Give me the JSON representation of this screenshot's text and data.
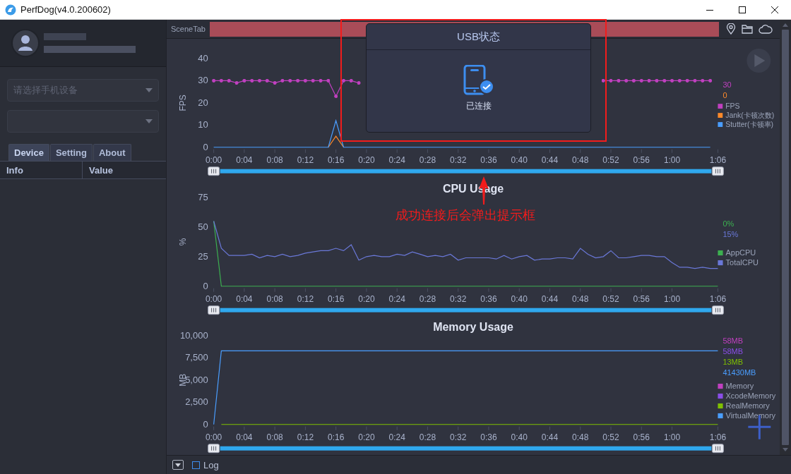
{
  "window": {
    "title": "PerfDog(v4.0.200602)"
  },
  "sidebar": {
    "device_select": {
      "placeholder": "请选择手机设备"
    },
    "tabs": [
      {
        "label": "Device",
        "selected": true
      },
      {
        "label": "Setting",
        "selected": false
      },
      {
        "label": "About",
        "selected": false
      }
    ],
    "table": {
      "columns": [
        "Info",
        "Value"
      ]
    }
  },
  "toolbar": {
    "tab": "SceneTab"
  },
  "sections": [
    {
      "readings": [
        {
          "text": "30",
          "color": "#c040c0"
        },
        {
          "text": "0",
          "color": "#ff8a2a"
        }
      ],
      "chart_data": {
        "type": "line",
        "ylabel": "FPS",
        "legend": "right",
        "x": [
          0,
          1,
          2,
          3,
          4,
          5,
          6,
          7,
          8,
          9,
          10,
          11,
          12,
          13,
          14,
          15,
          16,
          17,
          18,
          19,
          20,
          21,
          22,
          23,
          24,
          25,
          26,
          27,
          28,
          29,
          30,
          31,
          32,
          33,
          34,
          35,
          36,
          37,
          38,
          39,
          40,
          41,
          42,
          43,
          44,
          45,
          46,
          47,
          48,
          49,
          50,
          51,
          52,
          53,
          54,
          55,
          56,
          57,
          58,
          59,
          60,
          61,
          62,
          63,
          64,
          65
        ],
        "xlim": [
          0,
          66
        ],
        "ylim": [
          0,
          40
        ],
        "yticks": [
          0,
          10,
          20,
          30,
          40
        ],
        "xticks": [
          {
            "value": 0,
            "label": "0:00"
          },
          {
            "value": 4,
            "label": "0:04"
          },
          {
            "value": 8,
            "label": "0:08"
          },
          {
            "value": 12,
            "label": "0:12"
          },
          {
            "value": 16,
            "label": "0:16"
          },
          {
            "value": 20,
            "label": "0:20"
          },
          {
            "value": 24,
            "label": "0:24"
          },
          {
            "value": 28,
            "label": "0:28"
          },
          {
            "value": 32,
            "label": "0:32"
          },
          {
            "value": 36,
            "label": "0:36"
          },
          {
            "value": 40,
            "label": "0:40"
          },
          {
            "value": 44,
            "label": "0:44"
          },
          {
            "value": 48,
            "label": "0:48"
          },
          {
            "value": 52,
            "label": "0:52"
          },
          {
            "value": 56,
            "label": "0:56"
          },
          {
            "value": 60,
            "label": "1:00"
          },
          {
            "value": 66,
            "label": "1:06"
          }
        ],
        "series": [
          {
            "name": "FPS",
            "color": "#c040c0",
            "values": [
              30,
              30,
              30,
              29,
              30,
              30,
              30,
              30,
              29,
              30,
              30,
              30,
              30,
              30,
              30,
              30,
              23,
              30,
              30,
              29,
              null,
              null,
              null,
              null,
              null,
              null,
              null,
              null,
              null,
              null,
              null,
              null,
              null,
              null,
              null,
              null,
              null,
              null,
              null,
              null,
              null,
              null,
              null,
              null,
              null,
              null,
              null,
              null,
              null,
              null,
              null,
              30,
              30,
              30,
              30,
              30,
              30,
              30,
              30,
              30,
              30,
              30,
              30,
              30,
              30,
              30
            ]
          },
          {
            "name": "Jank(卡顿次数)",
            "color": "#ff8a2a",
            "values": [
              null,
              null,
              null,
              null,
              null,
              null,
              null,
              null,
              null,
              null,
              null,
              null,
              null,
              null,
              null,
              0,
              5,
              0,
              null,
              null,
              null,
              null,
              null,
              null,
              null,
              null,
              null,
              null,
              null,
              null,
              null,
              null,
              null,
              null,
              null,
              null,
              null,
              null,
              null,
              null,
              null,
              null,
              null,
              null,
              null,
              null,
              null,
              null,
              null,
              null,
              null,
              null,
              null,
              null,
              null,
              null,
              null,
              null,
              null,
              null,
              null,
              null,
              null,
              null,
              null,
              null
            ]
          },
          {
            "name": "Stutter(卡顿率)",
            "color": "#4a9eff",
            "values": [
              0,
              0,
              0,
              0,
              0,
              0,
              0,
              0,
              0,
              0,
              0,
              0,
              0,
              0,
              0,
              0,
              12,
              0,
              0,
              0,
              0,
              0,
              0,
              0,
              0,
              0,
              0,
              0,
              0,
              0,
              0,
              0,
              0,
              0,
              0,
              0,
              0,
              0,
              0,
              0,
              0,
              0,
              0,
              0,
              0,
              0,
              0,
              0,
              0,
              0,
              0,
              0,
              0,
              0,
              0,
              0,
              0,
              0,
              0,
              0,
              0,
              0,
              0,
              0,
              0,
              0
            ]
          }
        ]
      }
    },
    {
      "readings": [
        {
          "text": "0%",
          "color": "#3cb050"
        },
        {
          "text": "15%",
          "color": "#6a78d8"
        }
      ],
      "chart_data": {
        "type": "line",
        "title": "CPU Usage",
        "ylabel": "%",
        "legend": "right",
        "x": [
          0,
          1,
          2,
          3,
          4,
          5,
          6,
          7,
          8,
          9,
          10,
          11,
          12,
          13,
          14,
          15,
          16,
          17,
          18,
          19,
          20,
          21,
          22,
          23,
          24,
          25,
          26,
          27,
          28,
          29,
          30,
          31,
          32,
          33,
          34,
          35,
          36,
          37,
          38,
          39,
          40,
          41,
          42,
          43,
          44,
          45,
          46,
          47,
          48,
          49,
          50,
          51,
          52,
          53,
          54,
          55,
          56,
          57,
          58,
          59,
          60,
          61,
          62,
          63,
          64,
          65,
          66
        ],
        "xlim": [
          0,
          66
        ],
        "ylim": [
          0,
          75
        ],
        "yticks": [
          0,
          25,
          50,
          75
        ],
        "xticks": [
          {
            "value": 0,
            "label": "0:00"
          },
          {
            "value": 4,
            "label": "0:04"
          },
          {
            "value": 8,
            "label": "0:08"
          },
          {
            "value": 12,
            "label": "0:12"
          },
          {
            "value": 16,
            "label": "0:16"
          },
          {
            "value": 20,
            "label": "0:20"
          },
          {
            "value": 24,
            "label": "0:24"
          },
          {
            "value": 28,
            "label": "0:28"
          },
          {
            "value": 32,
            "label": "0:32"
          },
          {
            "value": 36,
            "label": "0:36"
          },
          {
            "value": 40,
            "label": "0:40"
          },
          {
            "value": 44,
            "label": "0:44"
          },
          {
            "value": 48,
            "label": "0:48"
          },
          {
            "value": 52,
            "label": "0:52"
          },
          {
            "value": 56,
            "label": "0:56"
          },
          {
            "value": 60,
            "label": "1:00"
          },
          {
            "value": 66,
            "label": "1:06"
          }
        ],
        "series": [
          {
            "name": "AppCPU",
            "color": "#3cb050",
            "values": [
              55,
              0,
              0,
              0,
              0,
              0,
              0,
              0,
              0,
              0,
              0,
              0,
              0,
              0,
              0,
              0,
              0,
              0,
              0,
              0,
              0,
              0,
              0,
              0,
              0,
              0,
              0,
              0,
              0,
              0,
              0,
              0,
              0,
              0,
              0,
              0,
              0,
              0,
              0,
              0,
              0,
              0,
              0,
              0,
              0,
              0,
              0,
              0,
              0,
              0,
              0,
              0,
              0,
              0,
              0,
              0,
              0,
              0,
              0,
              0,
              0,
              0,
              0,
              0,
              0,
              0,
              0
            ]
          },
          {
            "name": "TotalCPU",
            "color": "#6a78d8",
            "values": [
              55,
              32,
              26,
              26,
              26,
              27,
              24,
              26,
              25,
              27,
              25,
              26,
              28,
              29,
              30,
              30,
              32,
              30,
              35,
              22,
              25,
              26,
              25,
              25,
              27,
              26,
              29,
              27,
              25,
              26,
              25,
              27,
              22,
              24,
              24,
              24,
              24,
              23,
              26,
              23,
              25,
              26,
              22,
              23,
              23,
              24,
              24,
              23,
              32,
              27,
              24,
              25,
              30,
              24,
              24,
              25,
              26,
              26,
              25,
              25,
              20,
              16,
              16,
              15,
              16,
              15,
              15
            ]
          }
        ]
      }
    },
    {
      "readings": [
        {
          "text": "58MB",
          "color": "#c040c0"
        },
        {
          "text": "58MB",
          "color": "#8a4ee8"
        },
        {
          "text": "13MB",
          "color": "#7fc000"
        },
        {
          "text": "41430MB",
          "color": "#4a9eff"
        }
      ],
      "chart_data": {
        "type": "line",
        "title": "Memory Usage",
        "ylabel": "MB",
        "legend": "right",
        "x": [
          0,
          1,
          2,
          3,
          4,
          5,
          6,
          7,
          8,
          9,
          10,
          11,
          12,
          13,
          14,
          15,
          16,
          17,
          18,
          19,
          20,
          21,
          22,
          23,
          24,
          25,
          26,
          27,
          28,
          29,
          30,
          31,
          32,
          33,
          34,
          35,
          36,
          37,
          38,
          39,
          40,
          41,
          42,
          43,
          44,
          45,
          46,
          47,
          48,
          49,
          50,
          51,
          52,
          53,
          54,
          55,
          56,
          57,
          58,
          59,
          60,
          61,
          62,
          63,
          64,
          65,
          66
        ],
        "xlim": [
          0,
          66
        ],
        "ylim": [
          0,
          10000
        ],
        "yticks": [
          {
            "value": 0,
            "label": "0"
          },
          {
            "value": 2500,
            "label": "2,500"
          },
          {
            "value": 5000,
            "label": "5,000"
          },
          {
            "value": 7500,
            "label": "7,500"
          },
          {
            "value": 10000,
            "label": "10,000"
          }
        ],
        "xticks": [
          {
            "value": 0,
            "label": "0:00"
          },
          {
            "value": 4,
            "label": "0:04"
          },
          {
            "value": 8,
            "label": "0:08"
          },
          {
            "value": 12,
            "label": "0:12"
          },
          {
            "value": 16,
            "label": "0:16"
          },
          {
            "value": 20,
            "label": "0:20"
          },
          {
            "value": 24,
            "label": "0:24"
          },
          {
            "value": 28,
            "label": "0:28"
          },
          {
            "value": 32,
            "label": "0:32"
          },
          {
            "value": 36,
            "label": "0:36"
          },
          {
            "value": 40,
            "label": "0:40"
          },
          {
            "value": 44,
            "label": "0:44"
          },
          {
            "value": 48,
            "label": "0:48"
          },
          {
            "value": 52,
            "label": "0:52"
          },
          {
            "value": 56,
            "label": "0:56"
          },
          {
            "value": 60,
            "label": "1:00"
          },
          {
            "value": 66,
            "label": "1:06"
          }
        ],
        "series": [
          {
            "name": "Memory",
            "color": "#c040c0",
            "values": [
              null,
              null,
              null,
              null,
              null,
              null,
              null,
              null,
              null,
              null,
              null,
              null,
              null,
              null,
              null,
              null,
              null,
              null,
              null,
              null,
              null,
              null,
              null,
              null,
              null,
              null,
              null,
              null,
              null,
              null,
              null,
              null,
              null,
              null,
              null,
              null,
              null,
              null,
              null,
              null,
              null,
              null,
              null,
              null,
              null,
              null,
              null,
              null,
              null,
              null,
              null,
              null,
              null,
              null,
              null,
              null,
              null,
              null,
              null,
              null,
              null,
              null,
              null,
              null,
              null,
              null,
              null
            ]
          },
          {
            "name": "XcodeMemory",
            "color": "#8a4ee8",
            "values": [
              null,
              null,
              null,
              null,
              null,
              null,
              null,
              null,
              null,
              null,
              null,
              null,
              null,
              null,
              null,
              null,
              null,
              null,
              null,
              null,
              null,
              null,
              null,
              null,
              null,
              null,
              null,
              null,
              null,
              null,
              null,
              null,
              null,
              null,
              null,
              null,
              null,
              null,
              null,
              null,
              null,
              null,
              null,
              null,
              null,
              null,
              null,
              null,
              null,
              null,
              null,
              null,
              null,
              null,
              null,
              null,
              null,
              null,
              null,
              null,
              null,
              null,
              null,
              null,
              null,
              null,
              null
            ]
          },
          {
            "name": "RealMemory",
            "color": "#7fc000",
            "values": [
              null,
              0,
              0,
              0,
              0,
              0,
              0,
              0,
              0,
              0,
              0,
              0,
              0,
              0,
              0,
              0,
              0,
              0,
              0,
              0,
              0,
              0,
              0,
              0,
              0,
              0,
              0,
              0,
              0,
              0,
              0,
              0,
              0,
              0,
              0,
              0,
              0,
              0,
              0,
              0,
              0,
              0,
              0,
              0,
              0,
              0,
              0,
              0,
              0,
              0,
              0,
              0,
              0,
              0,
              0,
              0,
              0,
              0,
              0,
              0,
              0,
              0,
              0,
              0,
              0,
              0,
              0
            ]
          },
          {
            "name": "VirtualMemory",
            "color": "#4a9eff",
            "values": [
              0,
              8300,
              8300,
              8300,
              8300,
              8300,
              8300,
              8300,
              8300,
              8300,
              8300,
              8300,
              8300,
              8300,
              8300,
              8300,
              8300,
              8300,
              8300,
              8300,
              8300,
              8300,
              8300,
              8300,
              8300,
              8300,
              8300,
              8300,
              8300,
              8300,
              8300,
              8300,
              8300,
              8300,
              8300,
              8300,
              8300,
              8300,
              8300,
              8300,
              8300,
              8300,
              8300,
              8300,
              8300,
              8300,
              8300,
              8300,
              8300,
              8300,
              8300,
              8300,
              8300,
              8300,
              8300,
              8300,
              8300,
              8300,
              8300,
              8300,
              8300,
              8300,
              8300,
              8300,
              8300,
              8300,
              8300
            ]
          }
        ]
      }
    }
  ],
  "popup": {
    "title": "USB状态",
    "message": "已连接"
  },
  "annotation": {
    "text": "成功连接后会弹出提示框"
  },
  "bottom_bar": {
    "log": {
      "label": "Log",
      "checked": false
    }
  }
}
